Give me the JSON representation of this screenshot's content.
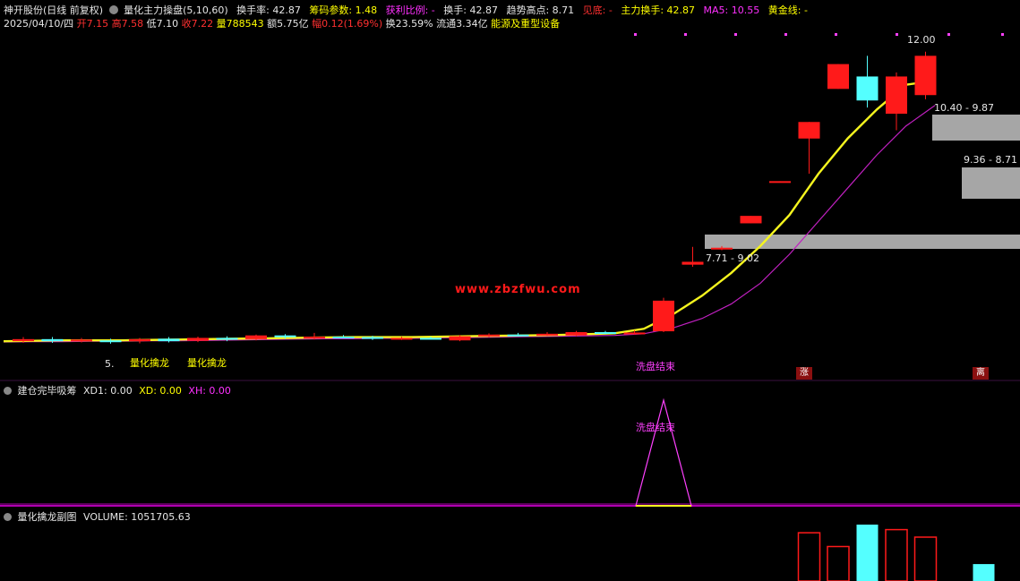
{
  "colors": {
    "up": "#ff1a1a",
    "down": "#54ffff",
    "ma_fast": "#f5f51e",
    "ma_slow": "#c020c0",
    "gray_band": "#a6a6a6",
    "pink": "#ff40ff",
    "header_white": "#e6e6e6",
    "header_yellow": "#ffff00",
    "header_red": "#ff3030",
    "header_magenta": "#ff30ff",
    "header_cyan": "#00e0e0",
    "separator": "#b000b0"
  },
  "header": {
    "stock": "神开股份(日线 前复权)",
    "indicator_name": "量化主力操盘(5,10,60)",
    "turnover_rate": "换手率: 42.87",
    "chip_param": "筹码参数: 1.48",
    "profit_ratio": "获利比例: -",
    "turnover": "换手: 42.87",
    "trend_high": "趋势高点: 8.71",
    "bottom_sign": "见底: -",
    "main_turnover": "主力换手: 42.87",
    "ma5": "MA5: 10.55",
    "gold_line": "黄金线: -"
  },
  "quote": {
    "date": "2025/04/10/四",
    "open": "开7.15",
    "high": "高7.58",
    "low": "低7.10",
    "close": "收7.22",
    "volume": "量788543",
    "amount": "额5.75亿",
    "change": "幅0.12(1.69%)",
    "turnover": "换23.59%",
    "float_cap": "流通3.34亿",
    "industry": "能源及重型设备"
  },
  "main_chart": {
    "watermark": "www.zbzfwu.com",
    "annotations": {
      "top_price": "12.00",
      "band1": "10.40 - 9.87",
      "band2": "9.36 - 8.71",
      "band3": "7.71 - 9.02",
      "wash_end": "洗盘结束",
      "signal_1": "量化擒龙",
      "signal_2": "量化擒龙",
      "left_tag": "5.",
      "rise_tag": "涨",
      "sell_tag": "离"
    }
  },
  "sub1": {
    "title": "建仓完毕吸筹",
    "xd1": "XD1: 0.00",
    "xd": "XD: 0.00",
    "xh": "XH: 0.00",
    "label": "洗盘结束"
  },
  "sub2": {
    "title": "量化擒龙副图",
    "volume": "VOLUME: 1051705.63"
  },
  "chart_data": {
    "type": "candlestick",
    "candles": [
      {
        "o": 5.3,
        "c": 5.35,
        "h": 5.4,
        "l": 5.26
      },
      {
        "o": 5.35,
        "c": 5.3,
        "h": 5.4,
        "l": 5.26
      },
      {
        "o": 5.31,
        "c": 5.34,
        "h": 5.38,
        "l": 5.27
      },
      {
        "o": 5.32,
        "c": 5.28,
        "h": 5.36,
        "l": 5.24
      },
      {
        "o": 5.3,
        "c": 5.35,
        "h": 5.38,
        "l": 5.25
      },
      {
        "o": 5.36,
        "c": 5.3,
        "h": 5.4,
        "l": 5.27
      },
      {
        "o": 5.31,
        "c": 5.38,
        "h": 5.41,
        "l": 5.28
      },
      {
        "o": 5.38,
        "c": 5.34,
        "h": 5.42,
        "l": 5.3
      },
      {
        "o": 5.35,
        "c": 5.44,
        "h": 5.46,
        "l": 5.32
      },
      {
        "o": 5.44,
        "c": 5.4,
        "h": 5.47,
        "l": 5.36
      },
      {
        "o": 5.4,
        "c": 5.41,
        "h": 5.5,
        "l": 5.34
      },
      {
        "o": 5.41,
        "c": 5.4,
        "h": 5.45,
        "l": 5.37
      },
      {
        "o": 5.4,
        "c": 5.36,
        "h": 5.43,
        "l": 5.33
      },
      {
        "o": 5.36,
        "c": 5.38,
        "h": 5.41,
        "l": 5.33
      },
      {
        "o": 5.38,
        "c": 5.37,
        "h": 5.41,
        "l": 5.34
      },
      {
        "o": 5.32,
        "c": 5.42,
        "h": 5.45,
        "l": 5.3
      },
      {
        "o": 5.42,
        "c": 5.46,
        "h": 5.49,
        "l": 5.4
      },
      {
        "o": 5.46,
        "c": 5.45,
        "h": 5.5,
        "l": 5.42
      },
      {
        "o": 5.45,
        "c": 5.48,
        "h": 5.52,
        "l": 5.43
      },
      {
        "o": 5.44,
        "c": 5.52,
        "h": 5.55,
        "l": 5.42
      },
      {
        "o": 5.52,
        "c": 5.5,
        "h": 5.55,
        "l": 5.47
      },
      {
        "o": 5.5,
        "c": 5.51,
        "h": 5.56,
        "l": 5.46
      },
      {
        "o": 5.54,
        "c": 6.28,
        "h": 6.35,
        "l": 5.52
      },
      {
        "o": 7.15,
        "c": 7.22,
        "h": 7.58,
        "l": 7.1
      },
      {
        "o": 7.55,
        "c": 7.56,
        "h": 7.6,
        "l": 7.5
      },
      {
        "o": 8.15,
        "c": 8.33,
        "h": 8.33,
        "l": 8.15
      },
      {
        "o": 9.16,
        "c": 9.17,
        "h": 9.17,
        "l": 9.15
      },
      {
        "o": 10.2,
        "c": 10.6,
        "h": 10.6,
        "l": 9.35
      },
      {
        "o": 11.4,
        "c": 12.0,
        "h": 12.0,
        "l": 11.4
      },
      {
        "o": 11.7,
        "c": 11.12,
        "h": 12.2,
        "l": 10.95
      },
      {
        "o": 10.8,
        "c": 11.7,
        "h": 11.8,
        "l": 10.4
      },
      {
        "o": 11.25,
        "c": 12.2,
        "h": 12.3,
        "l": 11.15
      }
    ],
    "ma_fast": [
      5.3,
      5.31,
      5.32,
      5.32,
      5.32,
      5.33,
      5.34,
      5.35,
      5.36,
      5.37,
      5.38,
      5.39,
      5.4,
      5.4,
      5.4,
      5.41,
      5.42,
      5.43,
      5.44,
      5.45,
      5.47,
      5.49,
      5.6,
      5.95,
      6.4,
      6.95,
      7.6,
      8.35,
      9.35,
      10.2,
      10.9,
      11.5,
      11.6
    ],
    "ma_slow": [
      5.28,
      5.29,
      5.29,
      5.3,
      5.3,
      5.31,
      5.31,
      5.32,
      5.33,
      5.34,
      5.35,
      5.36,
      5.36,
      5.37,
      5.37,
      5.38,
      5.39,
      5.4,
      5.41,
      5.42,
      5.43,
      5.44,
      5.48,
      5.62,
      5.85,
      6.2,
      6.7,
      7.4,
      8.2,
      9.0,
      9.8,
      10.5,
      11.0
    ],
    "volume": [
      {
        "x": 28,
        "v": 0.77,
        "up": true
      },
      {
        "x": 29,
        "v": 0.55,
        "up": true
      },
      {
        "x": 30,
        "v": 0.9,
        "up": false
      },
      {
        "x": 31,
        "v": 0.82,
        "up": true
      },
      {
        "x": 32,
        "v": 0.7,
        "up": true
      },
      {
        "x": 34,
        "v": 0.27,
        "up": false
      },
      {
        "x": 36,
        "v": 0.25,
        "up": false
      }
    ],
    "pulse": {
      "center": 22,
      "height": 1.0
    }
  }
}
